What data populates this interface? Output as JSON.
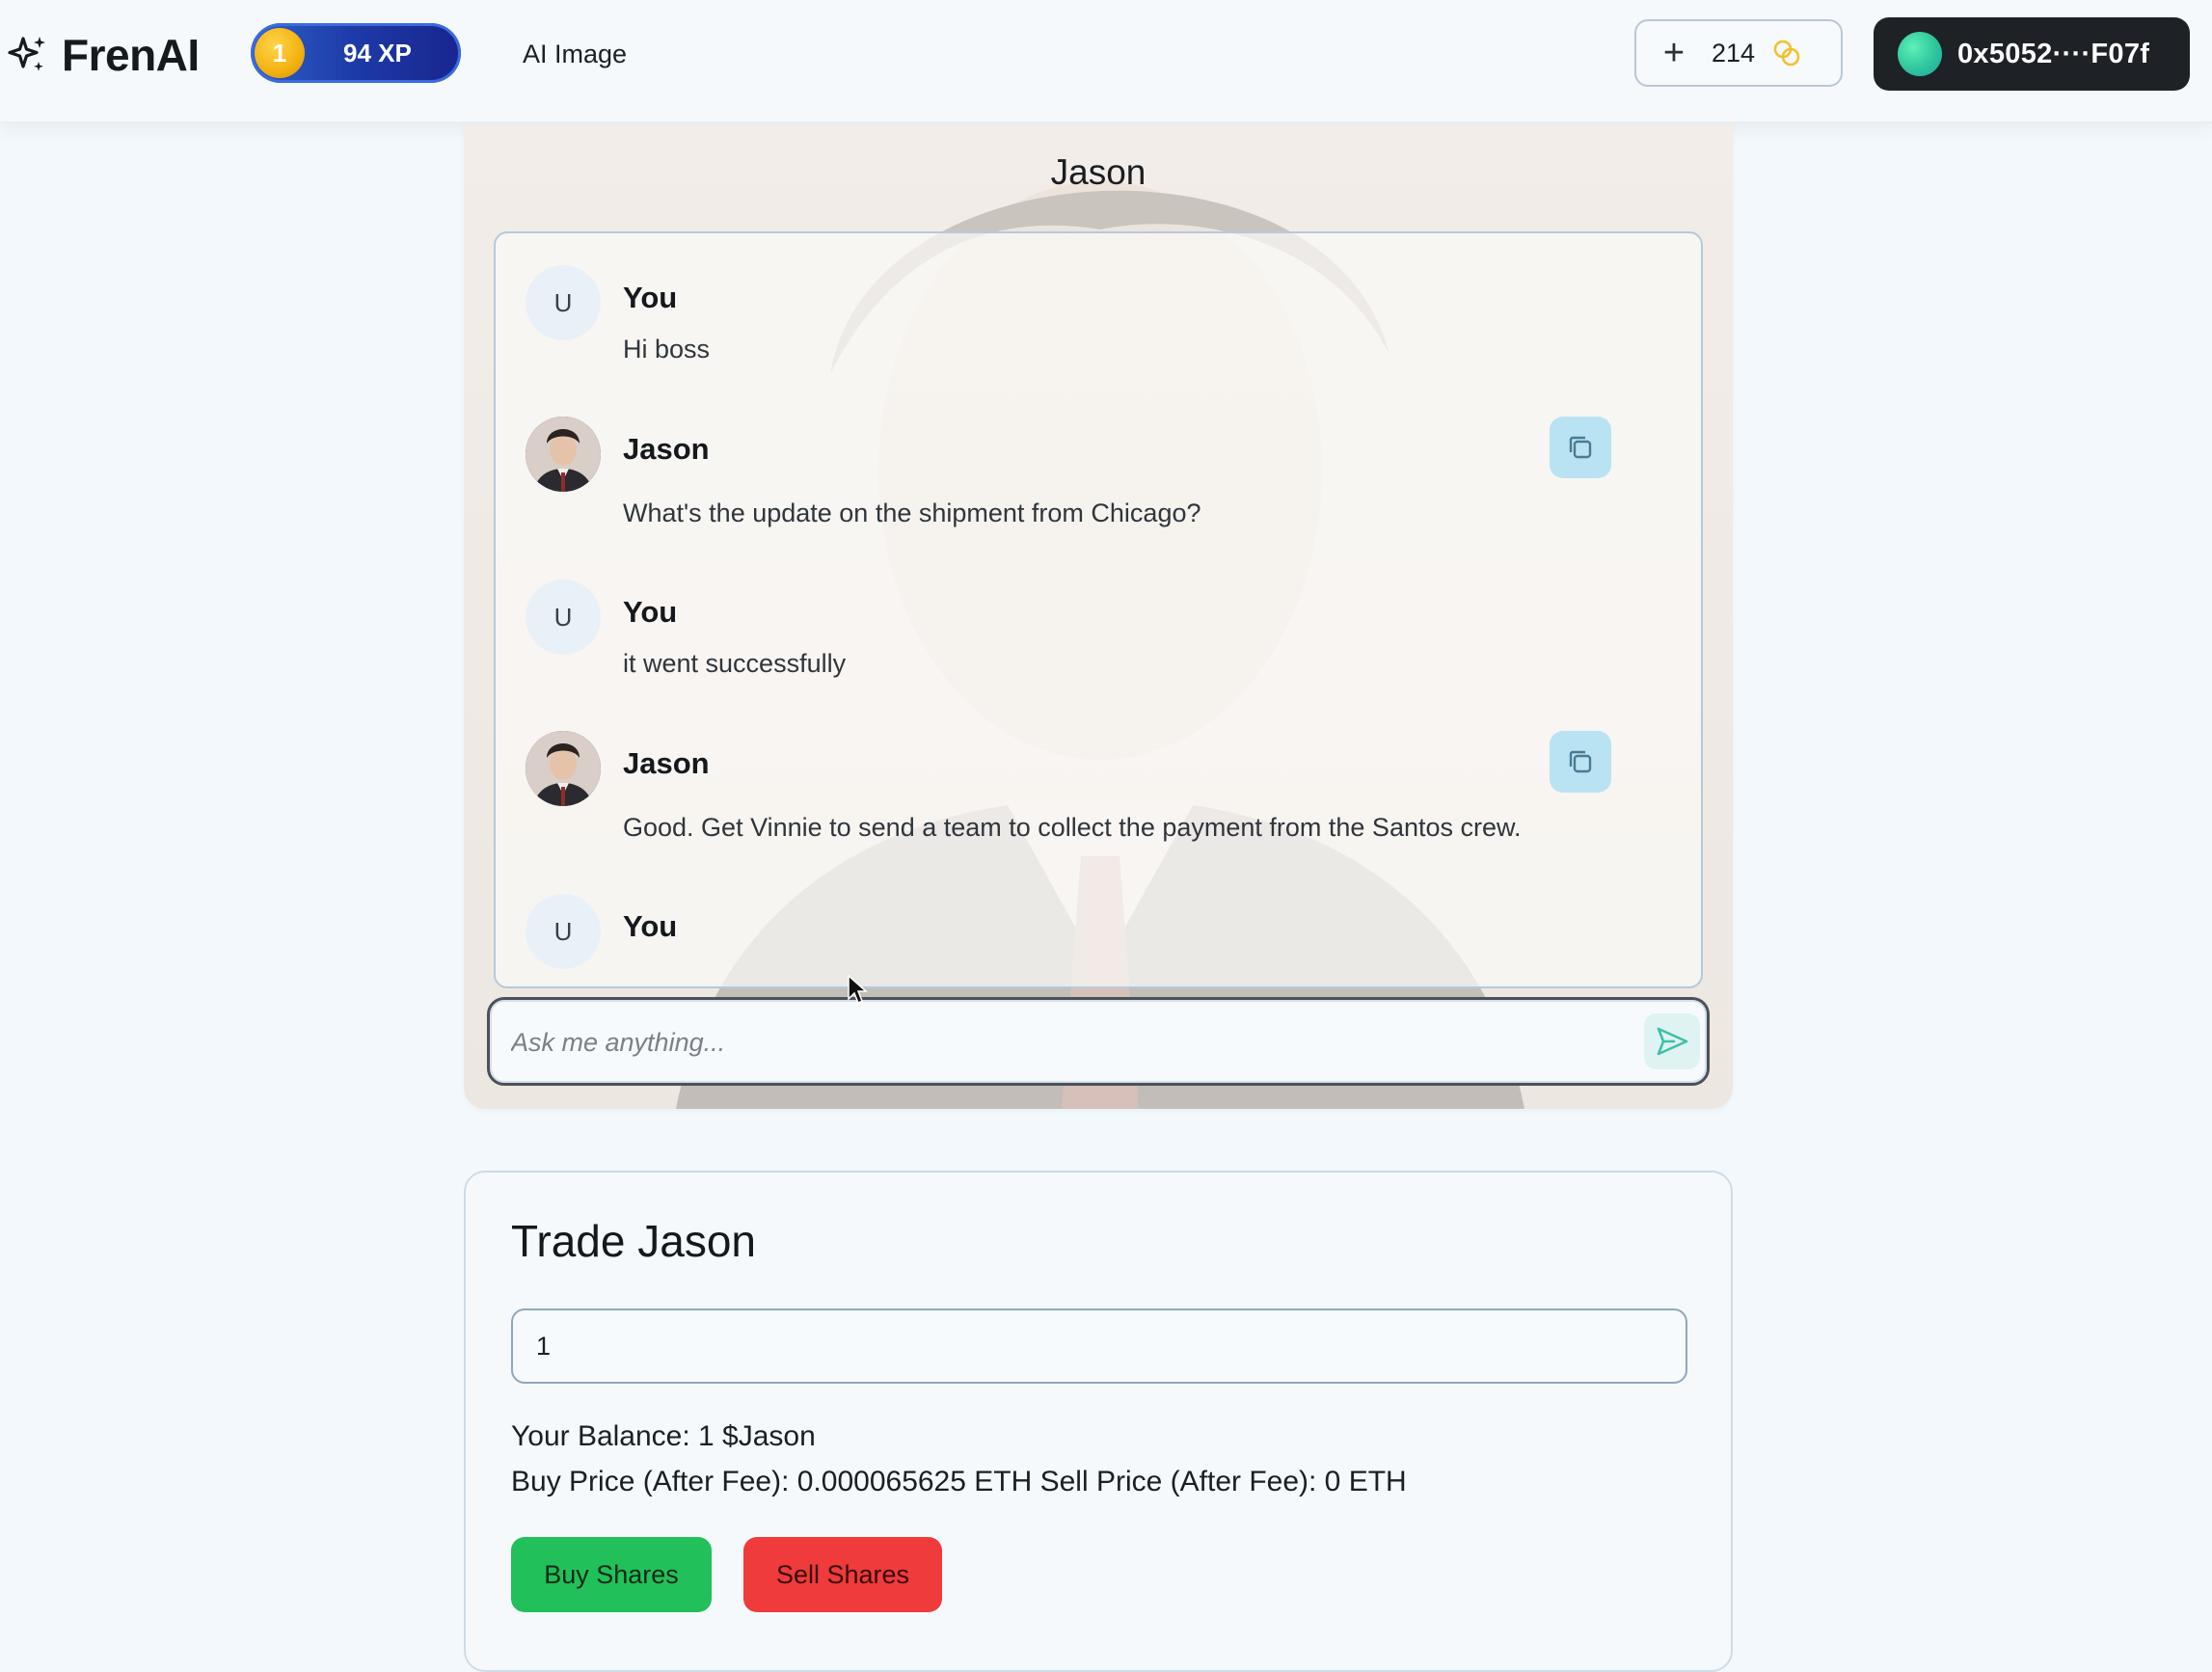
{
  "header": {
    "brand": "FrenAI",
    "level": "1",
    "xp_label": "94 XP",
    "nav_link": "AI Image",
    "credits_plus": "+",
    "credits_count": "214",
    "wallet_address": "0x5052····F07f"
  },
  "chat": {
    "title": "Jason",
    "messages": [
      {
        "sender": "You",
        "avatar": "U",
        "text": "Hi boss"
      },
      {
        "sender": "Jason",
        "avatar": "jason-avatar",
        "text": "What's the update on the shipment from Chicago?"
      },
      {
        "sender": "You",
        "avatar": "U",
        "text": "it went successfully"
      },
      {
        "sender": "Jason",
        "avatar": "jason-avatar",
        "text": "Good. Get Vinnie to send a team to collect the payment from the Santos crew."
      },
      {
        "sender": "You",
        "avatar": "U",
        "text": ""
      }
    ],
    "input_placeholder": "Ask me anything...",
    "input_value": ""
  },
  "trade": {
    "title": "Trade Jason",
    "amount_value": "1",
    "balance_line": "Your Balance: 1 $Jason",
    "price_line": "Buy Price (After Fee): 0.000065625 ETH Sell Price (After Fee): 0 ETH",
    "buy_label": "Buy Shares",
    "sell_label": "Sell Shares"
  },
  "colors": {
    "background": "#f3f8fc",
    "xp_pill": "#1d3aa7",
    "wallet_bg": "#1e2126",
    "buy_button": "#21c05a",
    "sell_button": "#ef3b3b",
    "copy_button": "#b9e3f3"
  },
  "icons": {
    "logo": "sparkle-icon",
    "credits": "coins-icon",
    "copy": "copy-icon",
    "send": "send-icon"
  }
}
